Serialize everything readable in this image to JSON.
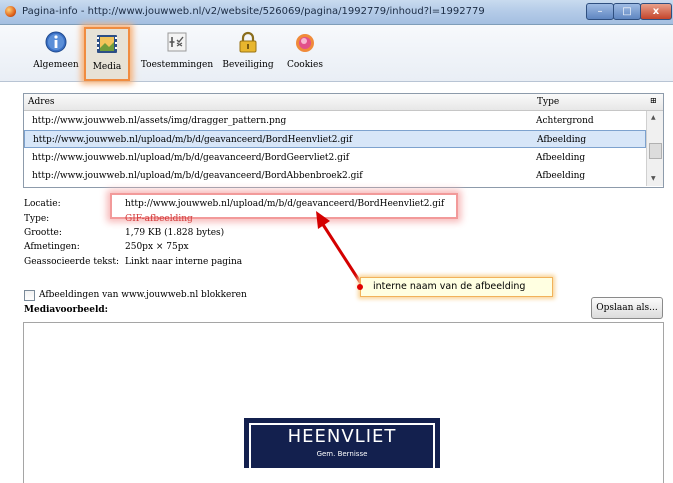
{
  "window": {
    "title": "Pagina-info - http://www.jouwweb.nl/v2/website/526069/pagina/1992779/inhoud?l=1992779",
    "minimize_label": "–",
    "maximize_label": "□",
    "close_label": "x"
  },
  "toolbar": {
    "tabs": [
      {
        "label": "Algemeen",
        "icon": "info-icon"
      },
      {
        "label": "Media",
        "icon": "media-icon",
        "selected": true
      },
      {
        "label": "Toestemmingen",
        "icon": "permissions-icon"
      },
      {
        "label": "Beveiliging",
        "icon": "lock-icon"
      },
      {
        "label": "Cookies",
        "icon": "cookie-icon"
      }
    ]
  },
  "media_list": {
    "columns": [
      "Adres",
      "Type"
    ],
    "rows": [
      {
        "address": "http://www.jouwweb.nl/assets/img/dragger_pattern.png",
        "type": "Achtergrond"
      },
      {
        "address": "http://www.jouwweb.nl/upload/m/b/d/geavanceerd/BordHeenvliet2.gif",
        "type": "Afbeelding",
        "selected": true
      },
      {
        "address": "http://www.jouwweb.nl/upload/m/b/d/geavanceerd/BordGeervliet2.gif",
        "type": "Afbeelding"
      },
      {
        "address": "http://www.jouwweb.nl/upload/m/b/d/geavanceerd/BordAbbenbroek2.gif",
        "type": "Afbeelding"
      }
    ]
  },
  "details": {
    "location_label": "Locatie:",
    "location_value": "http://www.jouwweb.nl/upload/m/b/d/geavanceerd/BordHeenvliet2.gif",
    "type_label": "Type:",
    "type_value": "GIF-afbeelding",
    "size_label": "Grootte:",
    "size_value": "1,79 KB (1.828 bytes)",
    "dimensions_label": "Afmetingen:",
    "dimensions_value": "250px × 75px",
    "alt_label": "Geassocieerde tekst:",
    "alt_value": "Linkt naar interne pagina"
  },
  "callout": {
    "text": "interne naam van de afbeelding"
  },
  "block_images": {
    "label": "Afbeeldingen van www.jouwweb.nl blokkeren",
    "checked": false
  },
  "save_button": "Opslaan als...",
  "preview": {
    "label": "Mediavoorbeeld:",
    "image_title": "HEENVLIET",
    "image_subtitle": "Gem. Bernisse"
  },
  "colors": {
    "highlight_orange": "#f08c40",
    "highlight_red": "#f29a9a",
    "arrow_red": "#d40000",
    "sign_blue": "#13204e",
    "type_value_red": "#d23a3a"
  }
}
